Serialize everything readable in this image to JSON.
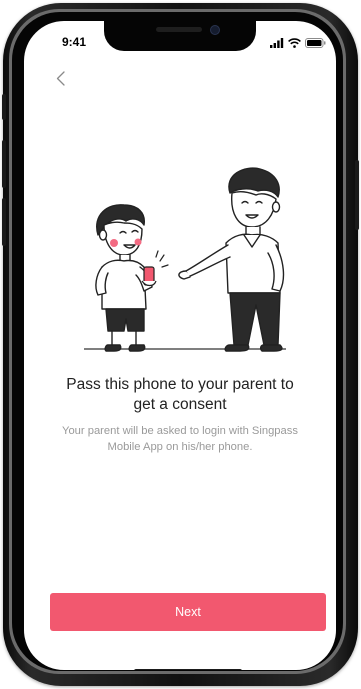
{
  "status_bar": {
    "time": "9:41",
    "icons": [
      "signal-icon",
      "wifi-icon",
      "battery-icon"
    ]
  },
  "nav": {
    "back_icon": "chevron-left-icon"
  },
  "content": {
    "illustration": "child-handing-phone-to-parent-illustration",
    "title": "Pass this phone to your parent to get a consent",
    "subtitle": "Your parent will be asked to login with Singpass Mobile App on his/her phone."
  },
  "actions": {
    "next_label": "Next"
  },
  "colors": {
    "accent": "#f2586f",
    "title_text": "#222222",
    "subtitle_text": "#9a9a9a",
    "phone_highlight": "#f2586f",
    "cheek": "#f36b83"
  }
}
